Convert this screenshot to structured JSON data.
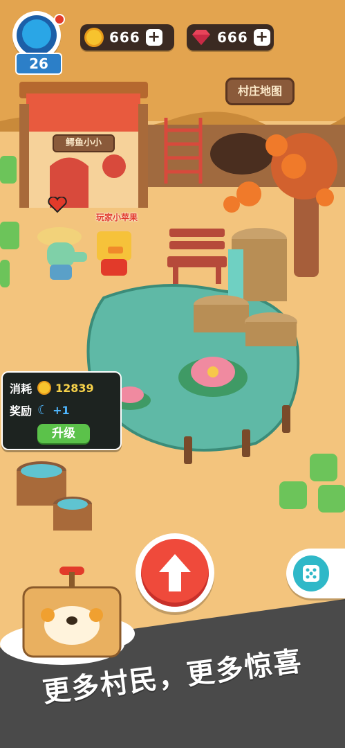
{
  "hud": {
    "level": "26",
    "coins": "666",
    "gems": "666",
    "plus": "+"
  },
  "signs": {
    "house": "鳄鱼小小",
    "map": "村庄地图"
  },
  "npc": {
    "player_label": "玩家小苹果"
  },
  "upgrade_panel": {
    "cost_label": "消耗",
    "cost_value": "12839",
    "reward_label": "奖励",
    "reward_value": "+1",
    "button_label": "升级"
  },
  "banner": {
    "text": "更多村民，更多惊喜"
  },
  "colors": {
    "accent_red": "#ef4a3b",
    "accent_green": "#5bc24a",
    "teal": "#2fb8c8",
    "hud_bg": "#3b2a22"
  }
}
